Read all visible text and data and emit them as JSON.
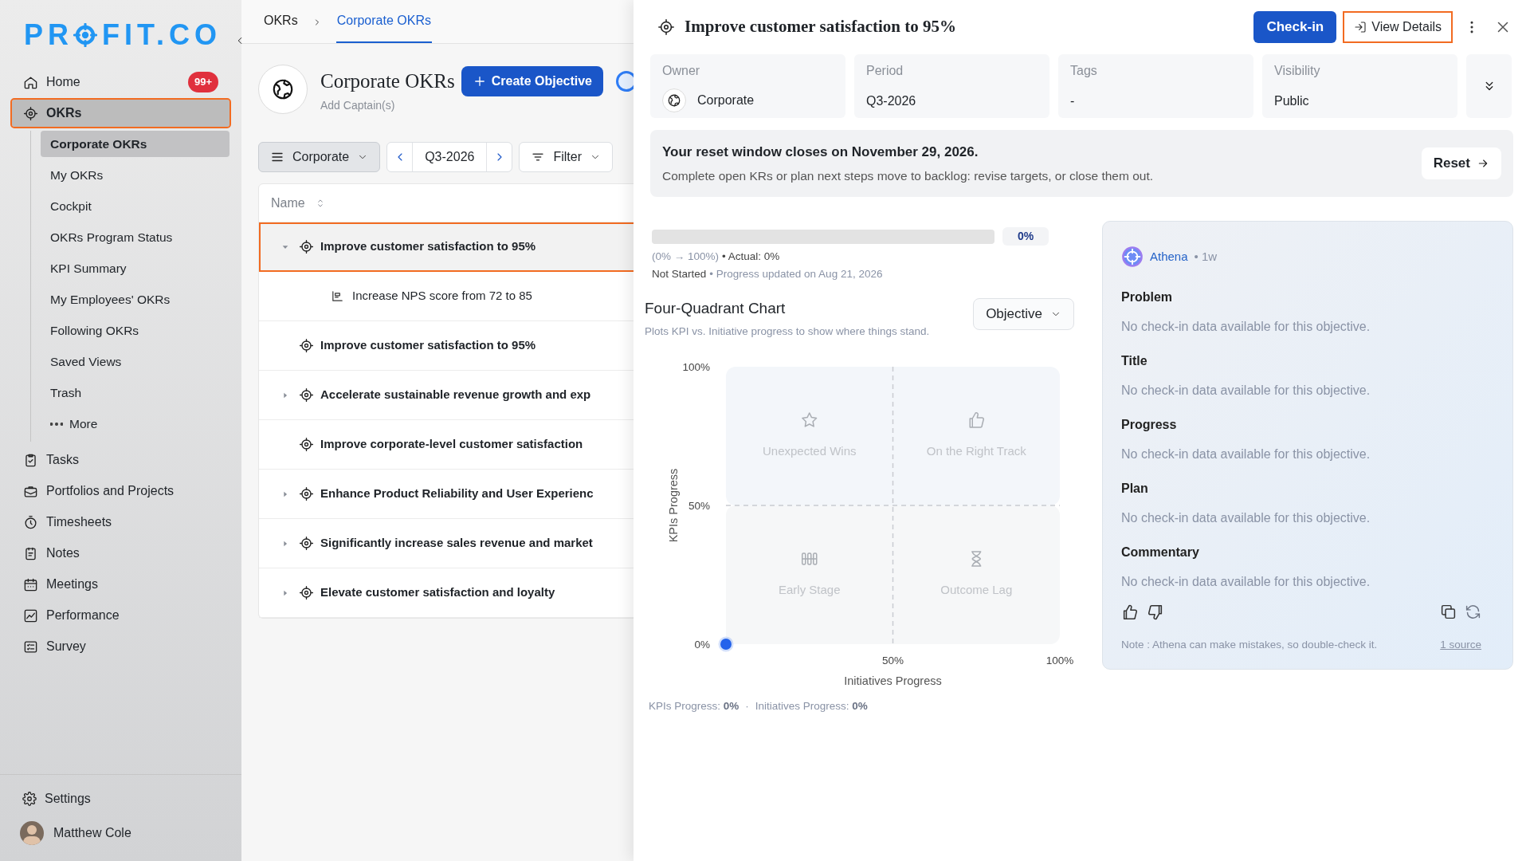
{
  "logo": {
    "left": "PR",
    "right": "FIT.CO"
  },
  "sidebar": {
    "items": [
      {
        "label": "Home",
        "badge": "99+",
        "selected": false,
        "highlighted": false
      },
      {
        "label": "OKRs",
        "selected": true,
        "highlighted": true,
        "children": [
          {
            "label": "Corporate OKRs",
            "selected": true
          },
          {
            "label": "My OKRs",
            "selected": false
          },
          {
            "label": "Cockpit",
            "selected": false
          },
          {
            "label": "OKRs Program Status",
            "selected": false
          },
          {
            "label": "KPI Summary",
            "selected": false
          },
          {
            "label": "My Employees' OKRs",
            "selected": false
          },
          {
            "label": "Following OKRs",
            "selected": false
          },
          {
            "label": "Saved Views",
            "selected": false
          },
          {
            "label": "Trash",
            "selected": false
          },
          {
            "label": "More",
            "selected": false,
            "kind": "more"
          }
        ]
      },
      {
        "label": "Tasks",
        "selected": false,
        "highlighted": false
      },
      {
        "label": "Portfolios and Projects",
        "selected": false,
        "highlighted": false
      },
      {
        "label": "Timesheets",
        "selected": false,
        "highlighted": false
      },
      {
        "label": "Notes",
        "selected": false,
        "highlighted": false
      },
      {
        "label": "Meetings",
        "selected": false,
        "highlighted": false
      },
      {
        "label": "Performance",
        "selected": false,
        "highlighted": false
      },
      {
        "label": "Survey",
        "selected": false,
        "highlighted": false
      }
    ],
    "settings": "Settings",
    "user": "Matthew Cole"
  },
  "breadcrumb": [
    {
      "label": "OKRs",
      "selected": false
    },
    {
      "label": "Corporate OKRs",
      "selected": true
    }
  ],
  "page": {
    "title": "Corporate OKRs",
    "subtitle": "Add Captain(s)",
    "create_button": "Create Objective"
  },
  "toolbar": {
    "view": "Corporate",
    "period": "Q3-2026",
    "filter": "Filter"
  },
  "table": {
    "column": "Name",
    "rows": [
      {
        "title": "Improve customer satisfaction to 95%",
        "expandable": true,
        "expanded": true,
        "highlighted": true,
        "children": [
          {
            "title": "Increase NPS score from 72 to 85",
            "kind": "key_result"
          }
        ]
      },
      {
        "title": "Improve customer satisfaction to 95%",
        "expandable": false,
        "highlighted": false
      },
      {
        "title": "Accelerate sustainable revenue growth and exp",
        "expandable": true,
        "expanded": false,
        "highlighted": false
      },
      {
        "title": "Improve corporate-level customer satisfaction",
        "expandable": false,
        "highlighted": false
      },
      {
        "title": "Enhance Product Reliability and User Experienc",
        "expandable": true,
        "expanded": false,
        "highlighted": false
      },
      {
        "title": "Significantly increase sales revenue and market",
        "expandable": true,
        "expanded": false,
        "highlighted": false
      },
      {
        "title": "Elevate customer satisfaction and loyalty",
        "expandable": true,
        "expanded": false,
        "highlighted": false
      }
    ]
  },
  "detail": {
    "title": "Improve customer satisfaction to 95%",
    "checkin_button": "Check-in",
    "view_details_button": {
      "label": "View Details",
      "highlighted": true
    },
    "fields": [
      {
        "label": "Owner",
        "value": "Corporate",
        "kind": "owner"
      },
      {
        "label": "Period",
        "value": "Q3-2026",
        "kind": "text"
      },
      {
        "label": "Tags",
        "value": "-",
        "kind": "text"
      },
      {
        "label": "Visibility",
        "value": "Public",
        "kind": "text"
      }
    ],
    "banner": {
      "title": "Your reset window closes on November 29, 2026.",
      "text": "Complete open KRs or plan next steps move to backlog: revise targets, or close them out.",
      "button": "Reset"
    },
    "progress": {
      "level": 0,
      "reading": "0%",
      "range": "(0% → 100%)",
      "actual": "• Actual: 0%",
      "status": "Not Started",
      "updated": "• Progress updated on Aug 21, 2026"
    },
    "chart": {
      "title": "Four-Quadrant Chart",
      "subtitle": "Plots KPI vs. Initiative progress to show where things stand.",
      "dropdown": "Objective",
      "quadrants": [
        {
          "label": "Unexpected Wins",
          "kind": "star"
        },
        {
          "label": "On the Right Track",
          "kind": "thumb"
        },
        {
          "label": "Early Stage",
          "kind": "bars"
        },
        {
          "label": "Outcome Lag",
          "kind": "hourglass"
        }
      ],
      "chart_data": {
        "type": "scatter",
        "xlabel": "Initiatives Progress",
        "ylabel": "KPIs Progress",
        "xlim": [
          0,
          100
        ],
        "ylim": [
          0,
          100
        ],
        "xticks": [
          {
            "value": 50,
            "label": "50%"
          },
          {
            "value": 100,
            "label": "100%"
          }
        ],
        "yticks": [
          {
            "value": 0,
            "label": "0%"
          },
          {
            "value": 50,
            "label": "50%"
          },
          {
            "value": 100,
            "label": "100%"
          }
        ],
        "x": [
          0
        ],
        "series": [
          {
            "color": "#2563eb",
            "values": [
              0
            ]
          }
        ]
      },
      "separator": "·",
      "footer": [
        {
          "label": "KPIs Progress:",
          "value": "0%"
        },
        {
          "label": "Initiatives Progress:",
          "value": "0%"
        }
      ]
    },
    "athena": {
      "name": "Athena",
      "time": "• 1w",
      "sections": [
        {
          "heading": "Problem",
          "text": "No check-in data available for this objective."
        },
        {
          "heading": "Title",
          "text": "No check-in data available for this objective."
        },
        {
          "heading": "Progress",
          "text": "No check-in data available for this objective."
        },
        {
          "heading": "Plan",
          "text": "No check-in data available for this objective."
        },
        {
          "heading": "Commentary",
          "text": "No check-in data available for this objective."
        }
      ],
      "note": "Note : Athena can make mistakes, so double-check it.",
      "source": "1 source"
    }
  }
}
